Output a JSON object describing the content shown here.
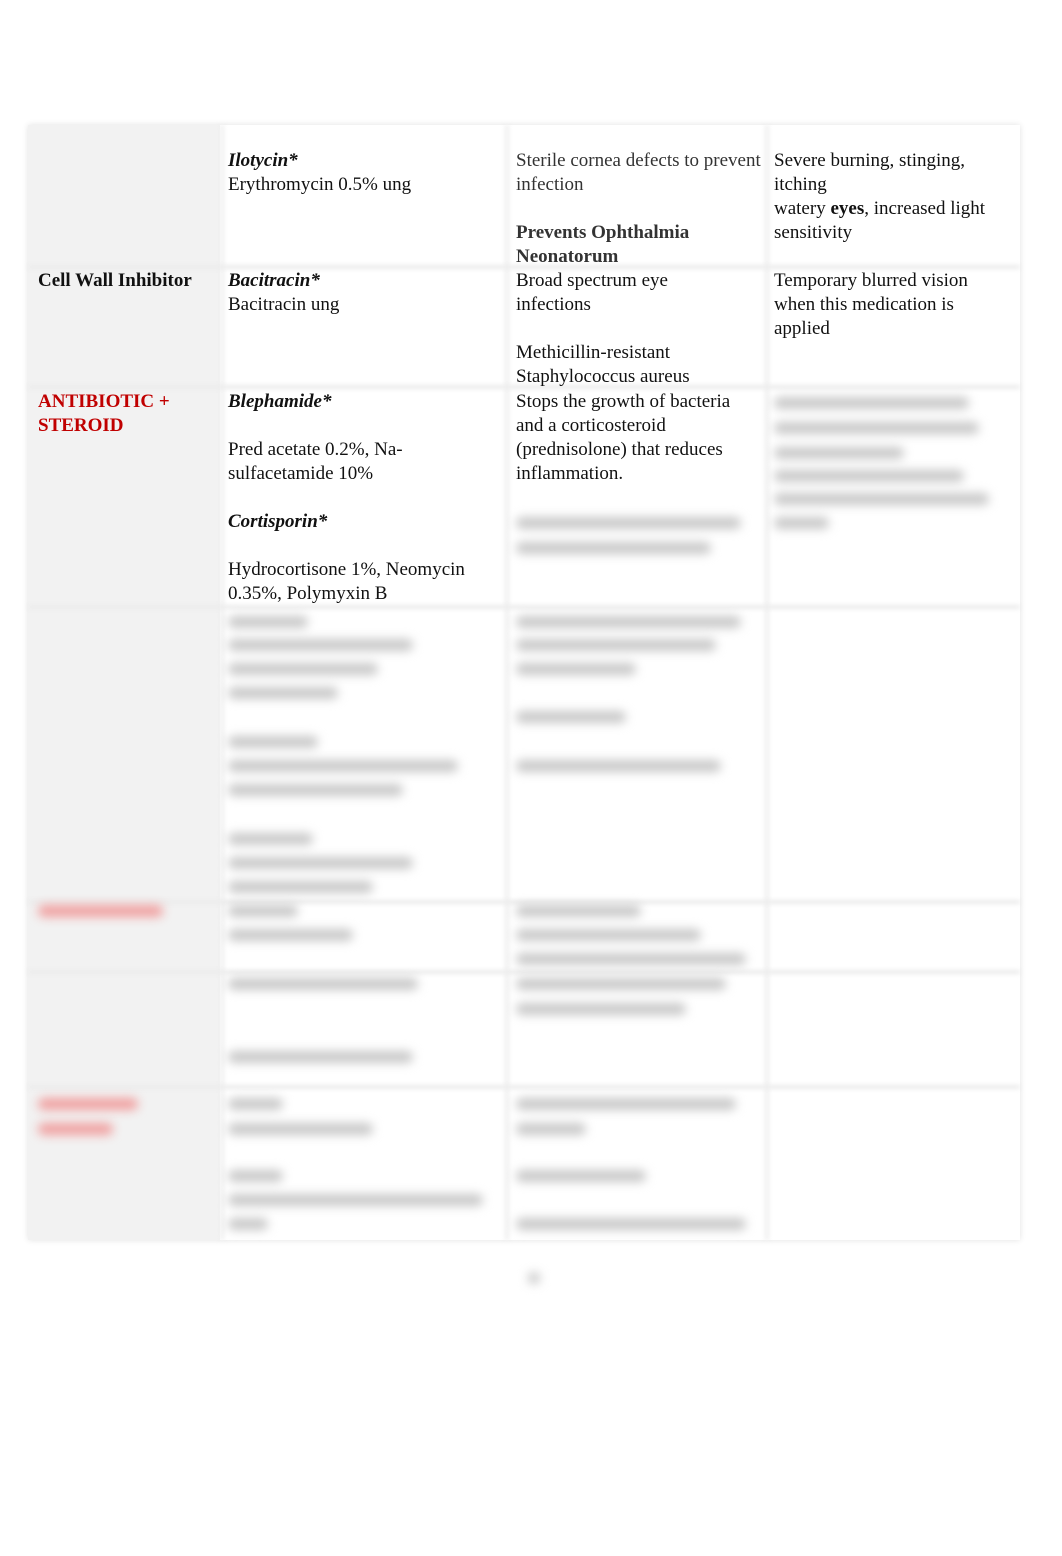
{
  "rows": [
    {
      "category": "",
      "drugs": [
        {
          "name": "Ilotycin*",
          "detail": "Erythromycin 0.5% ung"
        }
      ],
      "uses": [
        "Sterile cornea defects to prevent infection",
        "Prevents Ophthalmia Neonatorum"
      ],
      "side_effects": {
        "pre": "Severe burning, stinging, itching",
        "line2_a": "watery ",
        "line2_bold": "eyes",
        "line2_b": ", increased light sensitivity"
      }
    },
    {
      "category": "Cell Wall Inhibitor",
      "drugs": [
        {
          "name": "Bacitracin*",
          "detail": "Bacitracin ung"
        }
      ],
      "uses": [
        "Broad spectrum eye infections",
        "Methicillin-resistant Staphylococcus aureus"
      ],
      "side_effects": {
        "text": "Temporary blurred vision when this medication is applied"
      }
    },
    {
      "category": "ANTIBIOTIC + STEROID",
      "drugs": [
        {
          "name": "Blephamide*",
          "detail": "Pred acetate 0.2%, Na-sulfacetamide 10%"
        },
        {
          "name": "Cortisporin*",
          "detail": "Hydrocortisone 1%, Neomycin 0.35%, Polymyxin B"
        }
      ],
      "uses": [
        "Stops the growth of bacteria and a corticosteroid (prednisolone) that reduces inflammation."
      ]
    }
  ],
  "colors": {
    "category_red": "#c00000",
    "category_bg": "#f2f2f2"
  }
}
